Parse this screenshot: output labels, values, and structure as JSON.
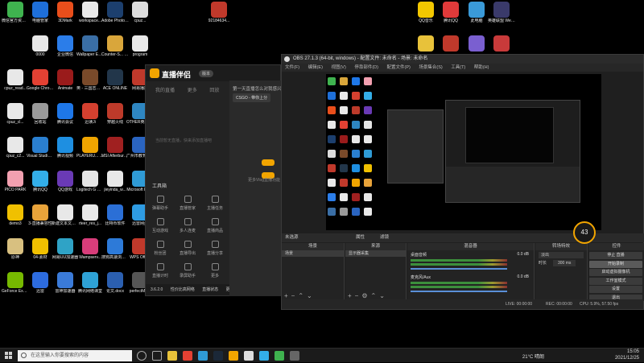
{
  "desktop": {
    "icons": [
      {
        "label": "微信官方资源工",
        "color": "#3fb34f"
      },
      {
        "label": "电脑管家",
        "color": "#1e6fd9"
      },
      {
        "label": "3DMark",
        "color": "#e94e1b"
      },
      {
        "label": "workspace...",
        "color": "#e8e8e8"
      },
      {
        "label": "Adobe Photosho...",
        "color": "#1c3f6e"
      },
      {
        "label": "cpuz...",
        "color": "#dcdcdc"
      },
      {
        "label": "92184634...",
        "color": "#c0392b"
      },
      {
        "label": "0000",
        "color": "#e8e8e8"
      },
      {
        "label": "企业微信",
        "color": "#2b7de9"
      },
      {
        "label": "Wallpaper Engine: ...",
        "color": "#3a6ea5"
      },
      {
        "label": "Counter-S... Global Off...",
        "color": "#d9a63b"
      },
      {
        "label": "program",
        "color": "#e8e8e8"
      },
      {
        "label": "cpuz_read...",
        "color": "#e8e8e8"
      },
      {
        "label": "Google Chrome",
        "color": "#e34133"
      },
      {
        "label": "Animate",
        "color": "#9a1b1b"
      },
      {
        "label": "英 - 三国志百战",
        "color": "#7a4a2a"
      },
      {
        "label": "ACE ONLINE",
        "color": "#22364a"
      },
      {
        "label": "网易播播",
        "color": "#c0392b"
      },
      {
        "label": "cpuz_cl...",
        "color": "#e8e8e8"
      },
      {
        "label": "回收站",
        "color": "#9a9a9a"
      },
      {
        "label": "腾讯会议",
        "color": "#1e77e8"
      },
      {
        "label": "迅读Ji",
        "color": "#d4402f"
      },
      {
        "label": "穿越火线",
        "color": "#bd3a2a"
      },
      {
        "label": "OTHER英雄联盟",
        "color": "#2e86c1"
      },
      {
        "label": "cpuz_c2...",
        "color": "#e8e8e8"
      },
      {
        "label": "Visual Studio Code",
        "color": "#2a7fd0"
      },
      {
        "label": "腾讯视频",
        "color": "#1e8fe1"
      },
      {
        "label": "PLAYERU... BATTLEGR...",
        "color": "#f0a500"
      },
      {
        "label": "MSI Afterburner",
        "color": "#a02020"
      },
      {
        "label": "广州市教育服务平台",
        "color": "#2a64c0"
      },
      {
        "label": "PICO PARK",
        "color": "#f2a0b0"
      },
      {
        "label": "腾讯QQ",
        "color": "#33aee8"
      },
      {
        "label": "QQ游戏",
        "color": "#6a3ab5"
      },
      {
        "label": "Logitech G HUB",
        "color": "#e5e5e5"
      },
      {
        "label": "jieyinda_w...",
        "color": "#e8e8e8"
      },
      {
        "label": "Microsoft Edge",
        "color": "#2f9bd6"
      },
      {
        "label": "demo3",
        "color": "#f0c000"
      },
      {
        "label": "3-直播兼容性",
        "color": "#e8a33a"
      },
      {
        "label": "新建文本文档.txt",
        "color": "#e8e8e8"
      },
      {
        "label": "rteer_res_j...",
        "color": "#e8e8e8"
      },
      {
        "label": "比特币软件",
        "color": "#2b6fd6"
      },
      {
        "label": "迅雷网盘",
        "color": "#2e9be2"
      },
      {
        "label": "原神",
        "color": "#d8c080"
      },
      {
        "label": "04-素材",
        "color": "#f0c000"
      },
      {
        "label": "网易UU加速器",
        "color": "#2fa3c6"
      },
      {
        "label": "Wampserv...",
        "color": "#d83d7a"
      },
      {
        "label": "搜狗高速浏览器",
        "color": "#2d7ad8"
      },
      {
        "label": "WPS Office",
        "color": "#c0392b"
      },
      {
        "label": "GeForce Experience",
        "color": "#76b900"
      },
      {
        "label": "迅雷",
        "color": "#2d6cdf"
      },
      {
        "label": "雷神加速器",
        "color": "#3a7ad8"
      },
      {
        "label": "腾讯网络课堂",
        "color": "#2ea2d6"
      },
      {
        "label": "论文.docx",
        "color": "#2b5fb0"
      },
      {
        "label": "perfectMo...",
        "color": "#555"
      },
      {
        "label": "QQ音乐",
        "color": "#f2c700"
      },
      {
        "label": "腾讯QQ",
        "color": "#e03a3a"
      },
      {
        "label": "此电脑",
        "color": "#3a9ad8"
      },
      {
        "label": "英雄联盟 WeGame平台",
        "color": "#3a3a6a"
      },
      {
        "label": "",
        "color": "#e8c23a"
      },
      {
        "label": "",
        "color": "#c0392b"
      },
      {
        "label": "",
        "color": "#7a5fd0"
      },
      {
        "label": "",
        "color": "#c83a3a"
      }
    ]
  },
  "live_app": {
    "name": "直播伴侣",
    "version": "版本",
    "tabs": [
      "我的直播",
      "更多",
      "回放"
    ],
    "placeholder_text": "当前暂无直播，快来添加直播吧",
    "tools_header": "工具箱",
    "tools": [
      "弹幕助手",
      "直播管家",
      "主播任务",
      "互动游戏",
      "多人连麦",
      "直播商品",
      "粉丝团",
      "直播导出",
      "直播分享",
      "直播计时",
      "录屏助手",
      "更多"
    ],
    "right_note": "第一天直播怎么对我感兴趣",
    "right_pill": "CSGO - 带你上分",
    "right_side": "更多Vlog直播功能",
    "footer": [
      "3.6.2.0",
      "性价比高网络",
      "直播状态",
      "更多"
    ]
  },
  "obs": {
    "title": "OBS 27.1.3 (64-bit, windows) - 配置文件: 未命名 - 场景: 未命名",
    "menu": [
      "文件(F)",
      "编辑(E)",
      "视图(V)",
      "停靠部件(D)",
      "配置文件(P)",
      "场景集合(S)",
      "工具(T)",
      "帮助(H)"
    ],
    "scene_bar": {
      "scene_label": "未选源",
      "props": "属性",
      "filters": "滤镜"
    },
    "panels": {
      "scenes": {
        "header": "场景",
        "items": [
          "场景"
        ]
      },
      "sources": {
        "header": "来源",
        "items": [
          "显示器采集"
        ]
      },
      "mixer": {
        "header": "混音器",
        "channels": [
          "桌面音频",
          "麦克风/Aux"
        ],
        "levels": [
          "0.0 dB",
          "0.0 dB"
        ]
      },
      "transitions": {
        "header": "转场特效",
        "type": "淡出",
        "duration_label": "时长",
        "duration": "300 ms"
      },
      "controls": {
        "header": "控件",
        "buttons": [
          "停止 直播",
          "开始录制",
          "启动虚拟摄像机",
          "工作室模式",
          "设置",
          "退出"
        ],
        "active_index": 1
      }
    },
    "status": {
      "live": "LIVE: 00:00:00",
      "rec": "REC: 00:00:00",
      "cpu": "CPU: 5.9%, 57.50 fps"
    },
    "gauge_value": "43"
  },
  "taskbar": {
    "search_placeholder": "在这里输入你要搜索的内容",
    "weather": "21°C 晴朗",
    "time": "15:05",
    "date": "2021/12/25",
    "apps": [
      "cortana",
      "task-view",
      "file-explorer",
      "chrome",
      "edge",
      "steam",
      "live-app",
      "obs",
      "qq",
      "wechat",
      "music"
    ]
  }
}
